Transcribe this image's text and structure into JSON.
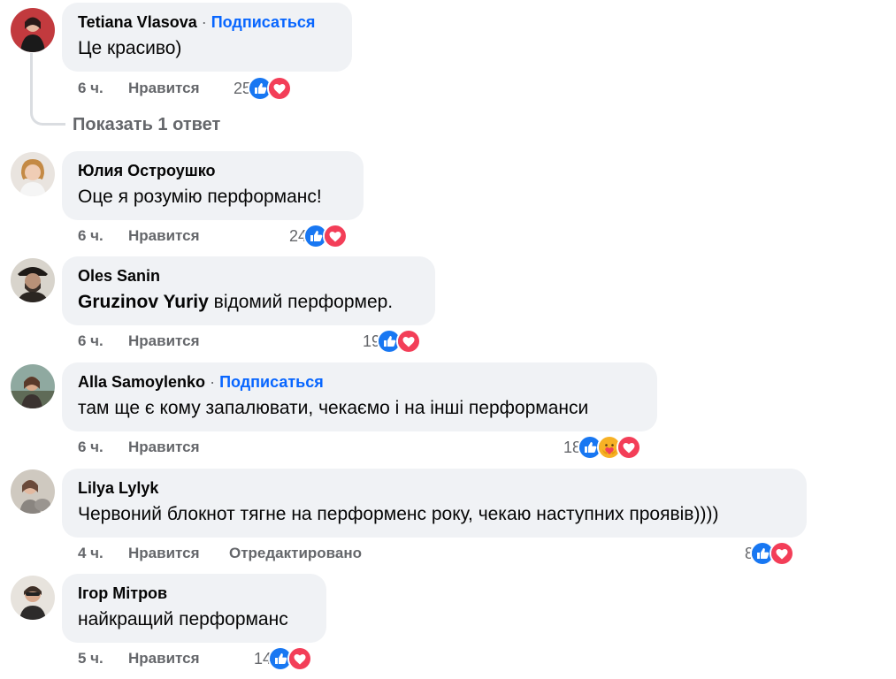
{
  "labels": {
    "like": "Нравится",
    "follow": "Подписаться",
    "dot": "·",
    "edited": "Отредактировано",
    "show_replies": "Показать 1 ответ"
  },
  "colors": {
    "bubble_bg": "#f0f2f5",
    "link_blue": "#0866ff",
    "meta_gray": "#65676b",
    "like_blue": "#1877f2",
    "love_red": "#f33e58",
    "care_yellow": "#f7b125"
  },
  "comments": [
    {
      "author": "Tetiana Vlasova",
      "follow": true,
      "mention": "",
      "text": "Це красиво)",
      "time": "6 ч.",
      "count": "25",
      "reactions": [
        "like-icon",
        "love-icon"
      ],
      "edited": false
    },
    {
      "author": "Юлия Остроушко",
      "follow": false,
      "mention": "",
      "text": "Оце я розумію перформанс!",
      "time": "6 ч.",
      "count": "24",
      "reactions": [
        "like-icon",
        "love-icon"
      ],
      "edited": false
    },
    {
      "author": "Oles Sanin",
      "follow": false,
      "mention": "Gruzinov Yuriy",
      "text": " відомий перформер.",
      "time": "6 ч.",
      "count": "19",
      "reactions": [
        "like-icon",
        "love-icon"
      ],
      "edited": false
    },
    {
      "author": "Alla Samoylenko",
      "follow": true,
      "mention": "",
      "text": "там ще є кому запалювати, чекаємо і на інші перформанси",
      "time": "6 ч.",
      "count": "18",
      "reactions": [
        "like-icon",
        "care-icon",
        "love-icon"
      ],
      "edited": false
    },
    {
      "author": "Lilya Lylyk",
      "follow": false,
      "mention": "",
      "text": "Червоний блокнот тягне на перформенс року, чекаю наступних проявів))))",
      "time": "4 ч.",
      "count": "8",
      "reactions": [
        "like-icon",
        "love-icon"
      ],
      "edited": true
    },
    {
      "author": "Ігор Мітров",
      "follow": false,
      "mention": "",
      "text": "найкращий перформанс",
      "time": "5 ч.",
      "count": "14",
      "reactions": [
        "like-icon",
        "love-icon"
      ],
      "edited": false
    }
  ]
}
